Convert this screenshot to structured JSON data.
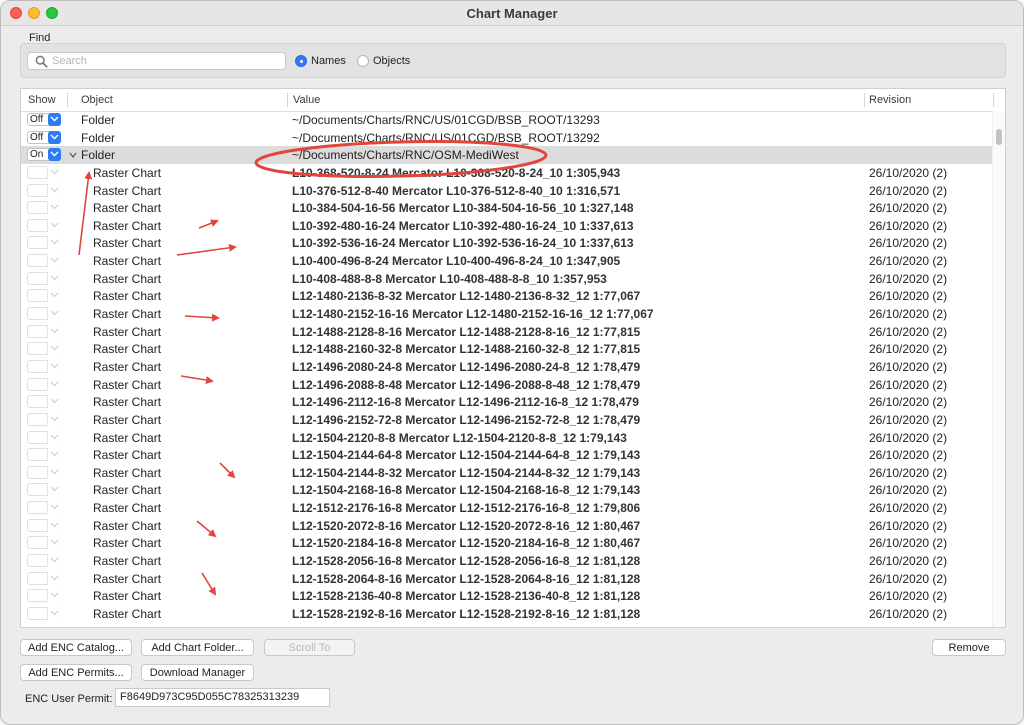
{
  "window": {
    "title": "Chart Manager"
  },
  "find": {
    "label": "Find",
    "search_placeholder": "Search",
    "radio_names": "Names",
    "radio_objects": "Objects",
    "selected": "Names"
  },
  "table": {
    "columns": {
      "show": "Show",
      "object": "Object",
      "value": "Value",
      "revision": "Revision"
    },
    "rows": [
      {
        "show": "Off",
        "object": "Folder",
        "value": "~/Documents/Charts/RNC/US/01CGD/BSB_ROOT/13293",
        "revision": ""
      },
      {
        "show": "Off",
        "object": "Folder",
        "value": "~/Documents/Charts/RNC/US/01CGD/BSB_ROOT/13292",
        "revision": ""
      },
      {
        "show": "On",
        "object": "Folder",
        "value": "~/Documents/Charts/RNC/OSM-MediWest",
        "revision": ""
      },
      {
        "show": "",
        "object": "Raster Chart",
        "value": "L10-368-520-8-24 Mercator L10-368-520-8-24_10 1:305,943",
        "revision": "26/10/2020 (2)"
      },
      {
        "show": "",
        "object": "Raster Chart",
        "value": "L10-376-512-8-40 Mercator L10-376-512-8-40_10 1:316,571",
        "revision": "26/10/2020 (2)"
      },
      {
        "show": "",
        "object": "Raster Chart",
        "value": "L10-384-504-16-56 Mercator L10-384-504-16-56_10 1:327,148",
        "revision": "26/10/2020 (2)"
      },
      {
        "show": "",
        "object": "Raster Chart",
        "value": "L10-392-480-16-24 Mercator L10-392-480-16-24_10 1:337,613",
        "revision": "26/10/2020 (2)"
      },
      {
        "show": "",
        "object": "Raster Chart",
        "value": "L10-392-536-16-24 Mercator L10-392-536-16-24_10 1:337,613",
        "revision": "26/10/2020 (2)"
      },
      {
        "show": "",
        "object": "Raster Chart",
        "value": "L10-400-496-8-24 Mercator L10-400-496-8-24_10 1:347,905",
        "revision": "26/10/2020 (2)"
      },
      {
        "show": "",
        "object": "Raster Chart",
        "value": "L10-408-488-8-8 Mercator L10-408-488-8-8_10 1:357,953",
        "revision": "26/10/2020 (2)"
      },
      {
        "show": "",
        "object": "Raster Chart",
        "value": "L12-1480-2136-8-32 Mercator L12-1480-2136-8-32_12 1:77,067",
        "revision": "26/10/2020 (2)"
      },
      {
        "show": "",
        "object": "Raster Chart",
        "value": "L12-1480-2152-16-16 Mercator L12-1480-2152-16-16_12 1:77,067",
        "revision": "26/10/2020 (2)"
      },
      {
        "show": "",
        "object": "Raster Chart",
        "value": "L12-1488-2128-8-16 Mercator L12-1488-2128-8-16_12 1:77,815",
        "revision": "26/10/2020 (2)"
      },
      {
        "show": "",
        "object": "Raster Chart",
        "value": "L12-1488-2160-32-8 Mercator L12-1488-2160-32-8_12 1:77,815",
        "revision": "26/10/2020 (2)"
      },
      {
        "show": "",
        "object": "Raster Chart",
        "value": "L12-1496-2080-24-8 Mercator L12-1496-2080-24-8_12 1:78,479",
        "revision": "26/10/2020 (2)"
      },
      {
        "show": "",
        "object": "Raster Chart",
        "value": "L12-1496-2088-8-48 Mercator L12-1496-2088-8-48_12 1:78,479",
        "revision": "26/10/2020 (2)"
      },
      {
        "show": "",
        "object": "Raster Chart",
        "value": "L12-1496-2112-16-8 Mercator L12-1496-2112-16-8_12 1:78,479",
        "revision": "26/10/2020 (2)"
      },
      {
        "show": "",
        "object": "Raster Chart",
        "value": "L12-1496-2152-72-8 Mercator L12-1496-2152-72-8_12 1:78,479",
        "revision": "26/10/2020 (2)"
      },
      {
        "show": "",
        "object": "Raster Chart",
        "value": "L12-1504-2120-8-8 Mercator L12-1504-2120-8-8_12 1:79,143",
        "revision": "26/10/2020 (2)"
      },
      {
        "show": "",
        "object": "Raster Chart",
        "value": "L12-1504-2144-64-8 Mercator L12-1504-2144-64-8_12 1:79,143",
        "revision": "26/10/2020 (2)"
      },
      {
        "show": "",
        "object": "Raster Chart",
        "value": "L12-1504-2144-8-32 Mercator L12-1504-2144-8-32_12 1:79,143",
        "revision": "26/10/2020 (2)"
      },
      {
        "show": "",
        "object": "Raster Chart",
        "value": "L12-1504-2168-16-8 Mercator L12-1504-2168-16-8_12 1:79,143",
        "revision": "26/10/2020 (2)"
      },
      {
        "show": "",
        "object": "Raster Chart",
        "value": "L12-1512-2176-16-8 Mercator L12-1512-2176-16-8_12 1:79,806",
        "revision": "26/10/2020 (2)"
      },
      {
        "show": "",
        "object": "Raster Chart",
        "value": "L12-1520-2072-8-16 Mercator L12-1520-2072-8-16_12 1:80,467",
        "revision": "26/10/2020 (2)"
      },
      {
        "show": "",
        "object": "Raster Chart",
        "value": "L12-1520-2184-16-8 Mercator L12-1520-2184-16-8_12 1:80,467",
        "revision": "26/10/2020 (2)"
      },
      {
        "show": "",
        "object": "Raster Chart",
        "value": "L12-1528-2056-16-8 Mercator L12-1528-2056-16-8_12 1:81,128",
        "revision": "26/10/2020 (2)"
      },
      {
        "show": "",
        "object": "Raster Chart",
        "value": "L12-1528-2064-8-16 Mercator L12-1528-2064-8-16_12 1:81,128",
        "revision": "26/10/2020 (2)"
      },
      {
        "show": "",
        "object": "Raster Chart",
        "value": "L12-1528-2136-40-8 Mercator L12-1528-2136-40-8_12 1:81,128",
        "revision": "26/10/2020 (2)"
      },
      {
        "show": "",
        "object": "Raster Chart",
        "value": "L12-1528-2192-8-16 Mercator L12-1528-2192-8-16_12 1:81,128",
        "revision": "26/10/2020 (2)"
      }
    ]
  },
  "buttons": {
    "add_enc_catalog": "Add ENC Catalog...",
    "add_chart_folder": "Add Chart Folder...",
    "scroll_to": "Scroll To",
    "remove": "Remove",
    "add_enc_permits": "Add ENC Permits...",
    "download_manager": "Download Manager"
  },
  "permit": {
    "label": "ENC User Permit:",
    "value": "F8649D973C95D055C78325313239"
  },
  "colors": {
    "accent": "#2b7cf6",
    "annotation": "#e2453c",
    "selected_row": "#dcdcdc"
  }
}
